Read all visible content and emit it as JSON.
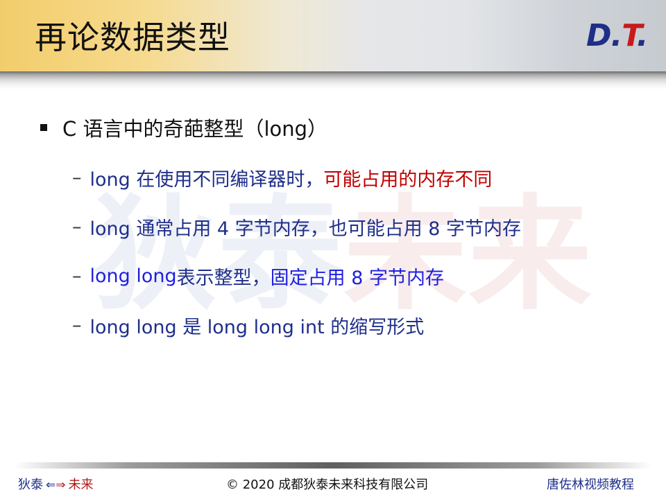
{
  "title": "再论数据类型",
  "logo": {
    "d": "D",
    "dot1": ".",
    "t": "T",
    "dot2": "."
  },
  "watermark": {
    "part1": "狄泰",
    "part2": "未来"
  },
  "bullet": "C 语言中的奇葩整型（long）",
  "sub_items": [
    {
      "part1": "long 在使用不同编译器时，",
      "part2": "可能占用的内存不同"
    },
    {
      "text": "long 通常占用 4 字节内存，也可能占用 8 字节内存"
    },
    {
      "part1": "long long",
      "part2": " 表示整型，",
      "part3": "固定占用 8 字节内存"
    },
    {
      "text": "long long 是 long long int 的缩写形式"
    }
  ],
  "dash": "–",
  "footer": {
    "left_part1": "狄泰",
    "left_arrow_left": "⇐",
    "left_arrow_right": "⇒",
    "left_part2": "未来",
    "center": "© 2020 成都狄泰未来科技有限公司",
    "right": "唐佐林视频教程"
  },
  "colors": {
    "navy_text": "#1f2f8a",
    "red_text": "#c00000",
    "blue_text": "#1f1fe0",
    "title_band_gold": "#f2cd6a"
  }
}
